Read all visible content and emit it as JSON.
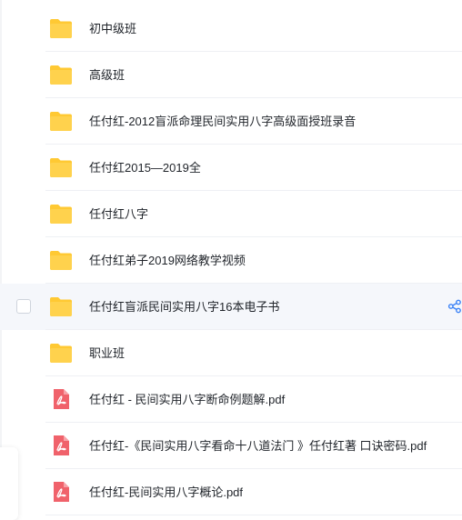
{
  "files": [
    {
      "name": "初中级班",
      "type": "folder"
    },
    {
      "name": "高级班",
      "type": "folder"
    },
    {
      "name": "任付红-2012盲派命理民间实用八字高级面授班录音",
      "type": "folder"
    },
    {
      "name": "任付红2015—2019全",
      "type": "folder"
    },
    {
      "name": "任付红八字",
      "type": "folder"
    },
    {
      "name": "任付红弟子2019网络教学视频",
      "type": "folder"
    },
    {
      "name": "任付红盲派民间实用八字16本电子书",
      "type": "folder",
      "hovered": true
    },
    {
      "name": "职业班",
      "type": "folder"
    },
    {
      "name": "任付红 - 民间实用八字断命例题解.pdf",
      "type": "pdf"
    },
    {
      "name": "任付红-《民间实用八字看命十八道法门 》任付红著 口诀密码.pdf",
      "type": "pdf"
    },
    {
      "name": "任付红-民间实用八字概论.pdf",
      "type": "pdf"
    }
  ],
  "icons": {
    "folder": "folder-icon",
    "pdf": "pdf-icon",
    "share": "share-icon"
  },
  "colors": {
    "folder": "#ffc933",
    "pdf": "#f0626b",
    "share": "#3b82f6"
  }
}
